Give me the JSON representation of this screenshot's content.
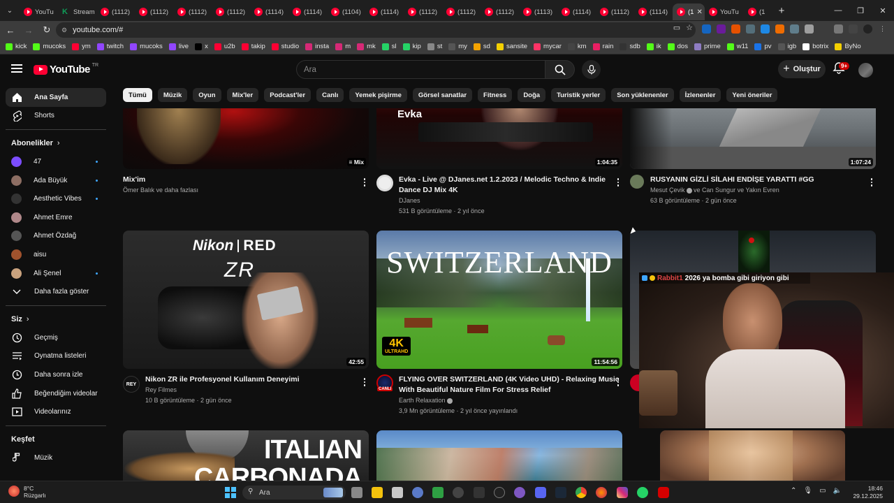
{
  "browser": {
    "tabs": [
      {
        "label": "YouTu",
        "icon": "youtube-icon"
      },
      {
        "label": "Stream",
        "icon": "green-k-icon"
      },
      {
        "label": "(1112)",
        "icon": "youtube-icon"
      },
      {
        "label": "(1112)",
        "icon": "youtube-icon"
      },
      {
        "label": "(1112)",
        "icon": "youtube-icon"
      },
      {
        "label": "(1112)",
        "icon": "youtube-icon"
      },
      {
        "label": "(1114)",
        "icon": "youtube-icon"
      },
      {
        "label": "(1114)",
        "icon": "youtube-icon"
      },
      {
        "label": "(1104)",
        "icon": "youtube-icon"
      },
      {
        "label": "(1114)",
        "icon": "youtube-icon"
      },
      {
        "label": "(1112)",
        "icon": "youtube-icon"
      },
      {
        "label": "(1112)",
        "icon": "youtube-icon"
      },
      {
        "label": "(1112)",
        "icon": "youtube-icon"
      },
      {
        "label": "(1113)",
        "icon": "youtube-icon"
      },
      {
        "label": "(1114)",
        "icon": "youtube-icon"
      },
      {
        "label": "(1112)",
        "icon": "youtube-icon"
      },
      {
        "label": "(1114)",
        "icon": "youtube-icon"
      }
    ],
    "active_tab": {
      "label": "(1"
    },
    "trailing_tabs": [
      {
        "label": "YouTu"
      },
      {
        "label": "(1"
      }
    ],
    "url": "youtube.com/#",
    "bookmarks": [
      {
        "label": "kick",
        "color": "#53fc18"
      },
      {
        "label": "mucoks",
        "color": "#53fc18"
      },
      {
        "label": "ym",
        "color": "#ff0033"
      },
      {
        "label": "twitch",
        "color": "#9146ff"
      },
      {
        "label": "mucoks",
        "color": "#9146ff"
      },
      {
        "label": "live",
        "color": "#9146ff"
      },
      {
        "label": "x",
        "color": "#000000"
      },
      {
        "label": "u2b",
        "color": "#ff0033"
      },
      {
        "label": "takip",
        "color": "#ff0033"
      },
      {
        "label": "studio",
        "color": "#ff0033"
      },
      {
        "label": "insta",
        "color": "#d62976"
      },
      {
        "label": "m",
        "color": "#d62976"
      },
      {
        "label": "mk",
        "color": "#d62976"
      },
      {
        "label": "sl",
        "color": "#25d366"
      },
      {
        "label": "kip",
        "color": "#25d366"
      },
      {
        "label": "st",
        "color": "#888888"
      },
      {
        "label": "my",
        "color": "#555555"
      },
      {
        "label": "sd",
        "color": "#f4a300"
      },
      {
        "label": "sansite",
        "color": "#f4d000"
      },
      {
        "label": "mycar",
        "color": "#ff3366"
      },
      {
        "label": "km",
        "color": "#444444"
      },
      {
        "label": "rain",
        "color": "#e91e63"
      },
      {
        "label": "sdb",
        "color": "#333333"
      },
      {
        "label": "ik",
        "color": "#53fc18"
      },
      {
        "label": "dos",
        "color": "#53fc18"
      },
      {
        "label": "prime",
        "color": "#8e7cc3"
      },
      {
        "label": "w11",
        "color": "#53fc18"
      },
      {
        "label": "pv",
        "color": "#1a73e8"
      },
      {
        "label": "igb",
        "color": "#555555"
      },
      {
        "label": "botrix",
        "color": "#ffffff"
      },
      {
        "label": "ByNo",
        "color": "#f4d000"
      }
    ]
  },
  "header": {
    "logo_text": "YouTube",
    "logo_sup": "TR",
    "search_placeholder": "Ara",
    "create_label": "Oluştur",
    "notif_count": "9+"
  },
  "sidebar": {
    "main": [
      {
        "label": "Ana Sayfa",
        "icon": "home-icon",
        "active": true
      },
      {
        "label": "Shorts",
        "icon": "shorts-icon"
      }
    ],
    "subs_title": "Abonelikler",
    "subs": [
      {
        "label": "47",
        "color": "#7c4dff",
        "dot": true
      },
      {
        "label": "Ada Büyük",
        "color": "#8d6e63",
        "dot": true
      },
      {
        "label": "Aesthetic Vibes",
        "color": "#333333",
        "dot": true
      },
      {
        "label": "Ahmet Emre",
        "color": "#b0888a",
        "dot": false
      },
      {
        "label": "Ahmet Özdağ",
        "color": "#555555",
        "dot": false
      },
      {
        "label": "aisu",
        "color": "#a0522d",
        "dot": false
      },
      {
        "label": "Ali Şenel",
        "color": "#c9a27e",
        "dot": true
      }
    ],
    "more_label": "Daha fazla göster",
    "you_title": "Siz",
    "you": [
      {
        "label": "Geçmiş",
        "icon": "history-icon"
      },
      {
        "label": "Oynatma listeleri",
        "icon": "playlist-icon"
      },
      {
        "label": "Daha sonra izle",
        "icon": "clock-icon"
      },
      {
        "label": "Beğendiğim videolar",
        "icon": "thumbs-up-icon"
      },
      {
        "label": "Videolarınız",
        "icon": "your-videos-icon"
      }
    ],
    "explore_title": "Keşfet",
    "explore": [
      {
        "label": "Müzik",
        "icon": "music-icon"
      }
    ]
  },
  "chips": [
    "Tümü",
    "Müzik",
    "Oyun",
    "Mix'ler",
    "Podcast'ler",
    "Canlı",
    "Yemek pişirme",
    "Görsel sanatlar",
    "Fitness",
    "Doğa",
    "Turistik yerler",
    "Son yüklenenler",
    "İzlenenler",
    "Yeni öneriler"
  ],
  "videos": {
    "v1": {
      "title": "Mix'im",
      "channel": "Ömer Balık ve daha fazlası",
      "duration": "Mix"
    },
    "v2": {
      "title1": "Evka - Live @ DJanes.net 1.2.2023 / Melodic Techno & Indie",
      "title2": "Dance DJ Mix 4K",
      "channel": "DJanes",
      "meta": "531 B görüntüleme · 2 yıl önce",
      "duration": "1:04:35",
      "thumb_text": "Evka"
    },
    "v3": {
      "title": "RUSYANIN GİZLİ SİLAHI ENDİŞE YARATTI #GG",
      "channel": "Mesut Çevik",
      "channel_suffix": "ve Can Sungur ve Yakın Evren",
      "meta": "63 B görüntüleme · 2 gün önce",
      "duration": "1:07:24"
    },
    "v4": {
      "title": "Nikon ZR ile Profesyonel Kullanım Deneyimi",
      "channel": "Rey Filmes",
      "meta": "10 B görüntüleme · 2 gün önce",
      "duration": "42:55",
      "thumb_text1": "Nikon",
      "thumb_text2": "RED",
      "thumb_text3": "ZR",
      "avatar_text": "REY"
    },
    "v5": {
      "title1": "FLYING OVER SWITZERLAND (4K Video UHD) - Relaxing Music",
      "title2": "With Beautiful Nature Film For Stress Relief",
      "channel": "Earth Relaxation",
      "meta": "3,9 Mn görüntüleme · 2 yıl önce yayınlandı",
      "duration": "11:54:56",
      "thumb_text": "SWITZERLAND",
      "badge_4k": "4K",
      "badge_uhd": "ULTRAHD",
      "live_badge": "CANLI"
    },
    "v7": {
      "thumb_text1": "ITALIAN",
      "thumb_text2": "CARBONADA"
    }
  },
  "overlay": {
    "chat_user": "Rabbit1",
    "chat_text": "2026 ya bomba gibi giriyon gibi"
  },
  "taskbar": {
    "temp": "8°C",
    "weather": "Rüzgarlı",
    "search": "Ara",
    "time": "18:46",
    "date": "29.12.2025"
  }
}
